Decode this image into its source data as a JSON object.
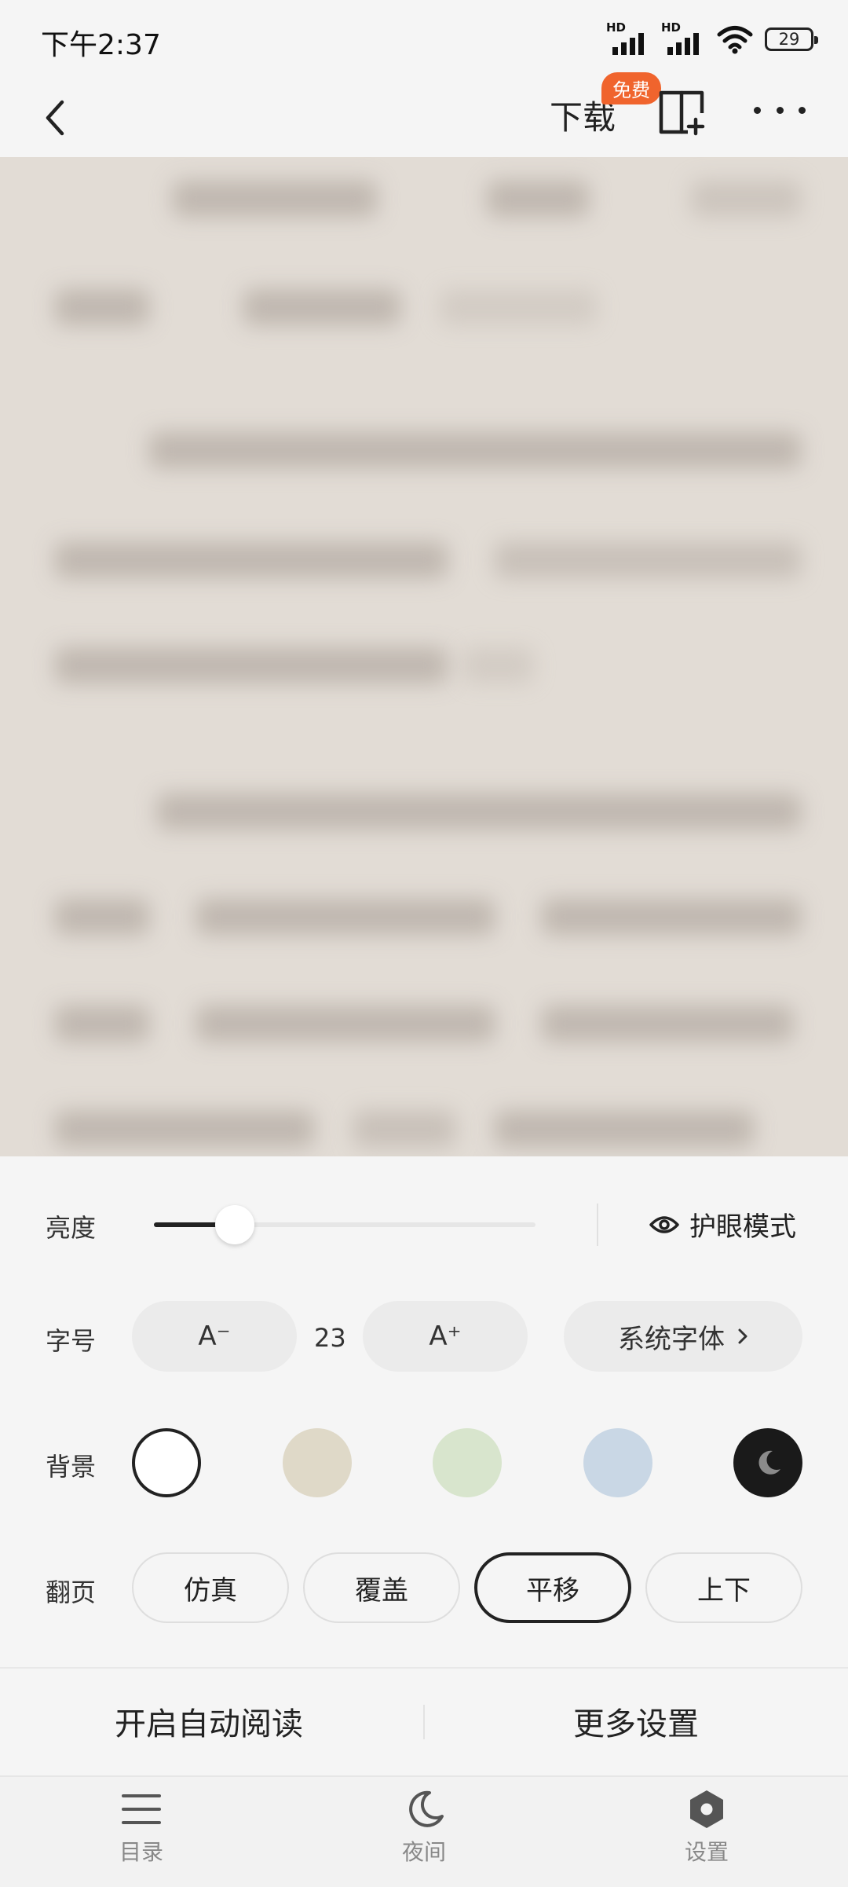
{
  "status_bar": {
    "time": "下午2:37",
    "battery": "29",
    "signal_label": "HD"
  },
  "nav": {
    "download_label": "下载",
    "free_badge": "免费"
  },
  "settings": {
    "brightness_label": "亮度",
    "brightness_level": 0.15,
    "eye_mode_label": "护眼模式",
    "font_size_label": "字号",
    "font_decrease": "A⁻",
    "font_increase": "A⁺",
    "font_size_value": "23",
    "font_family_label": "系统字体",
    "background_label": "背景",
    "backgrounds": [
      "#ffffff",
      "#dfd9c8",
      "#d8e5cd",
      "#c9d7e5",
      "#1a1a1a"
    ],
    "page_turn_label": "翻页",
    "page_turn_options": [
      "仿真",
      "覆盖",
      "平移",
      "上下"
    ],
    "page_turn_selected": "平移"
  },
  "actions": {
    "auto_read": "开启自动阅读",
    "more_settings": "更多设置"
  },
  "tabs": [
    {
      "label": "目录",
      "icon": "list-icon"
    },
    {
      "label": "夜间",
      "icon": "moon-icon"
    },
    {
      "label": "设置",
      "icon": "settings-icon"
    }
  ]
}
